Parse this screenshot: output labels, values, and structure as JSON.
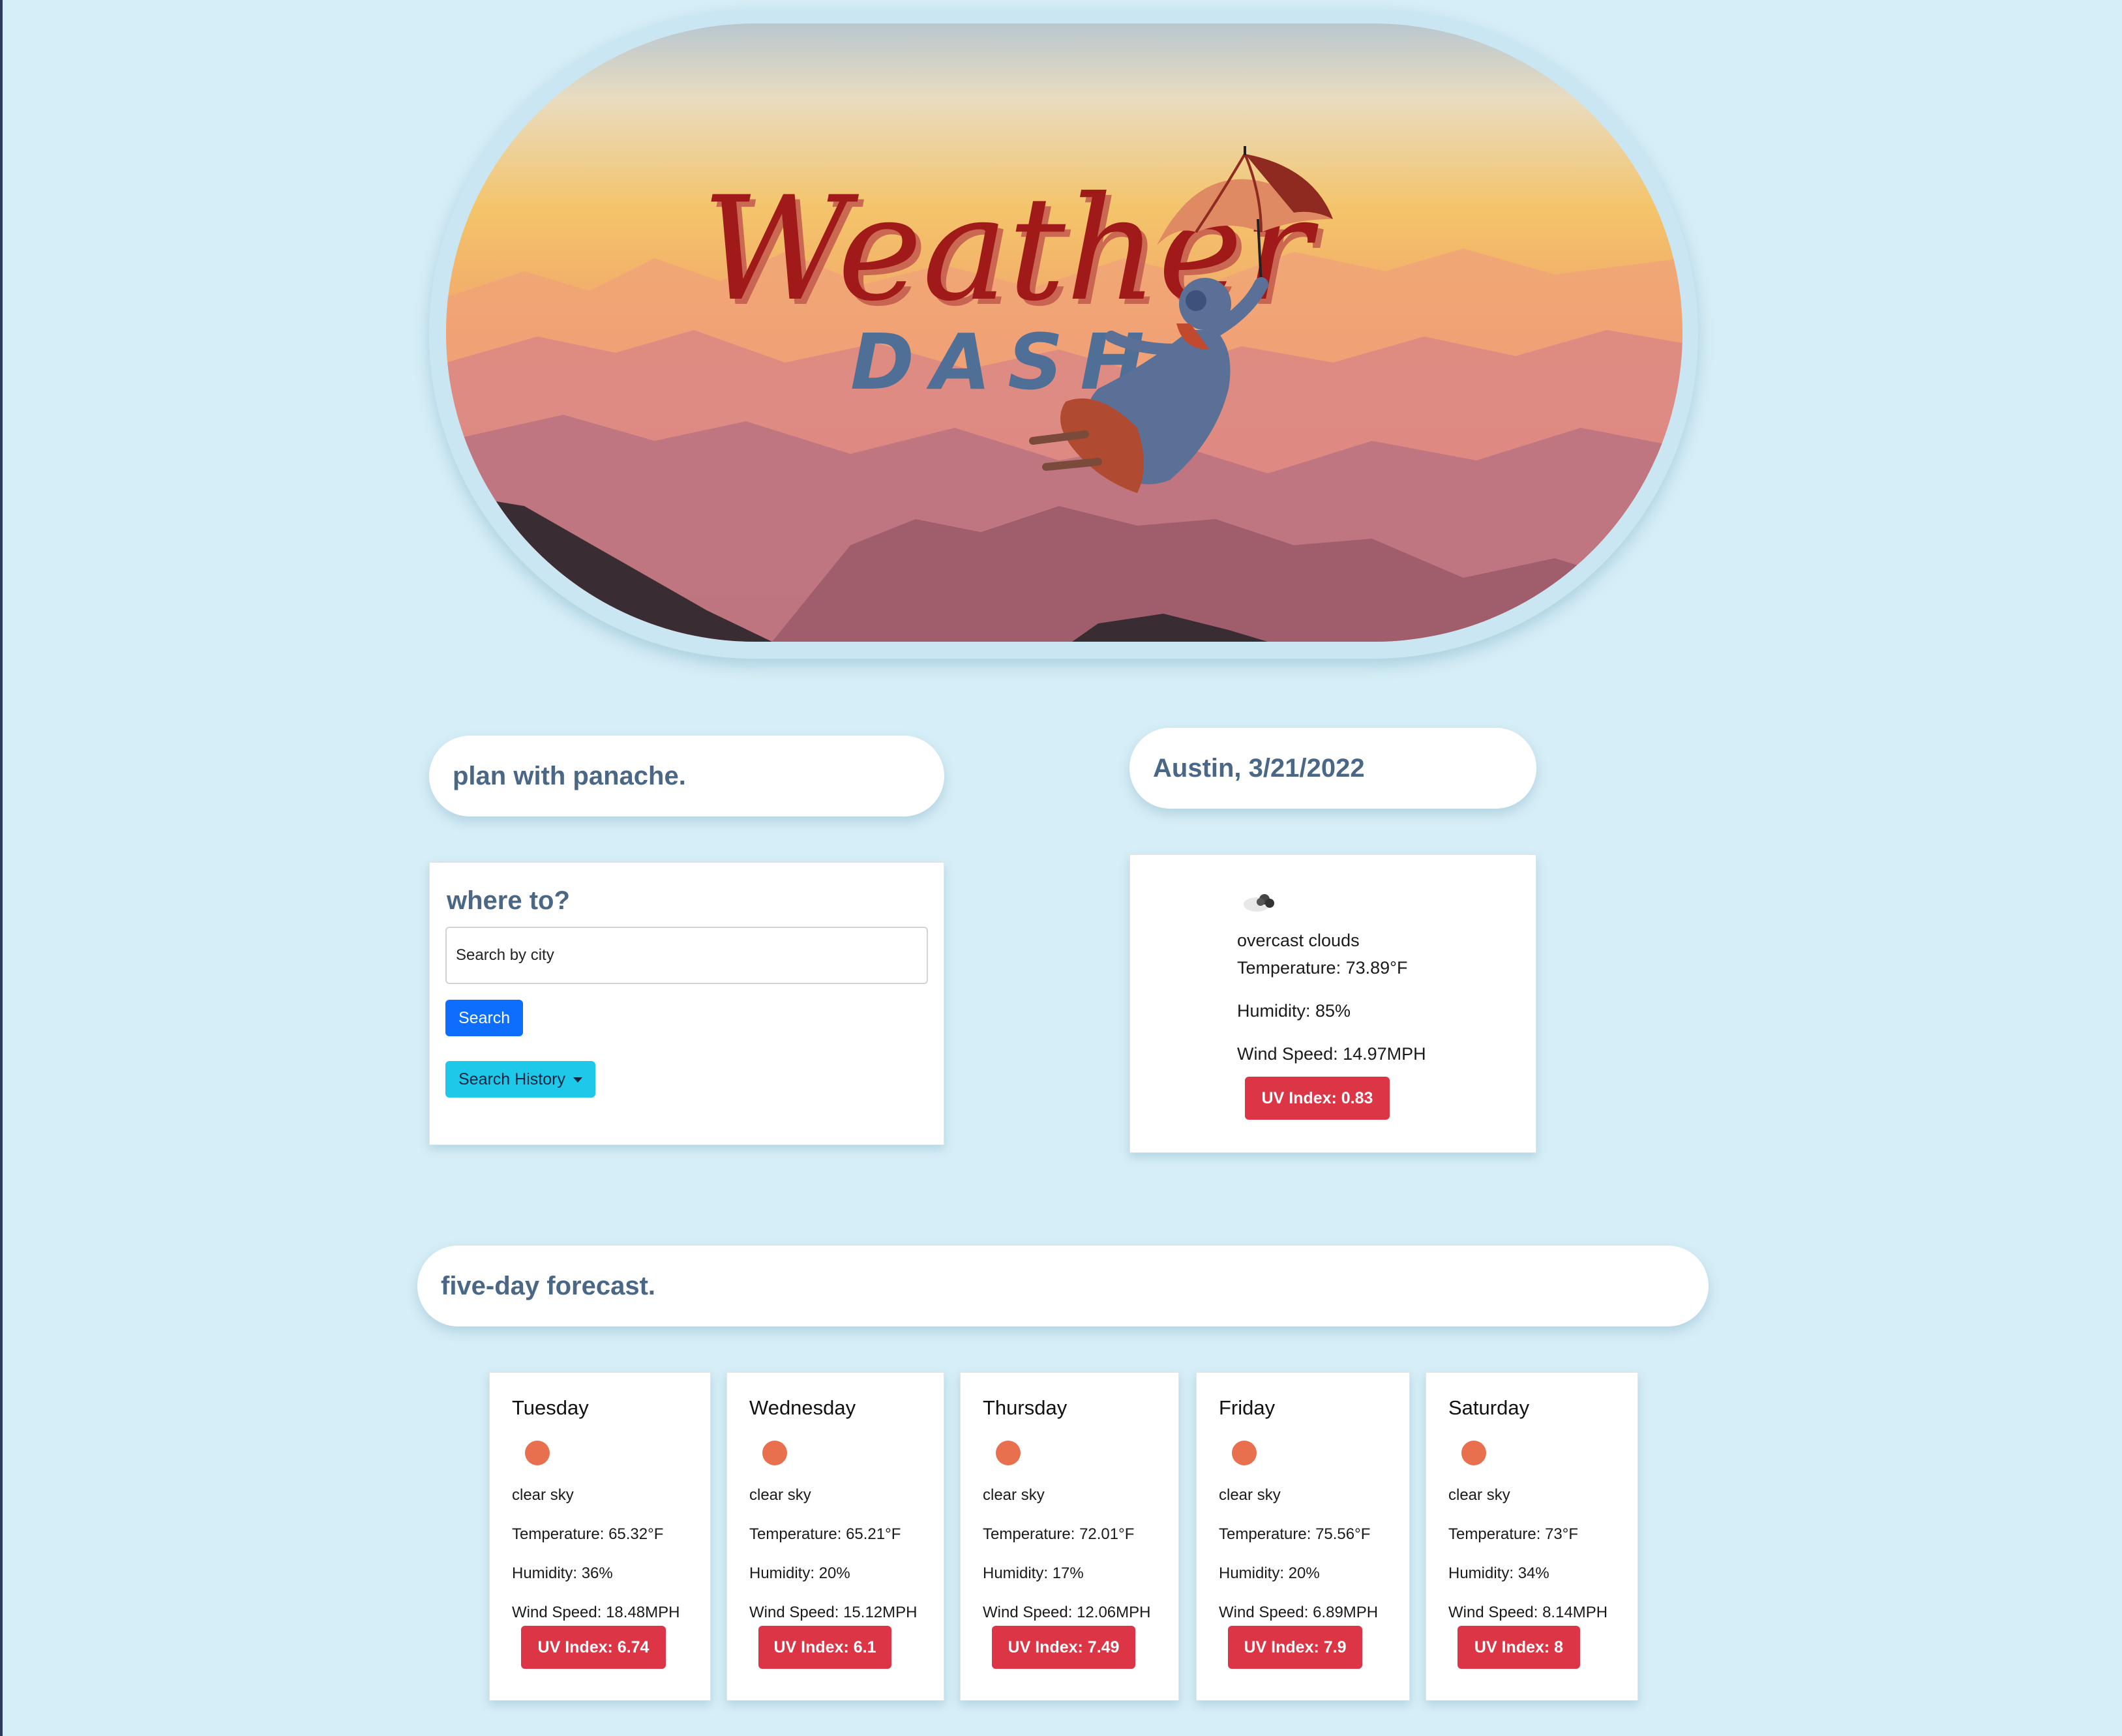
{
  "hero": {
    "logo_script": "Weather",
    "logo_sub": "DASH"
  },
  "tagline": "plan with panache.",
  "search": {
    "heading": "where to?",
    "placeholder": "Search by city",
    "search_label": "Search",
    "history_label": "Search History"
  },
  "current": {
    "city_date": "Austin, 3/21/2022",
    "icon": "cloud-icon",
    "description": "overcast clouds",
    "temperature": "Temperature: 73.89°F",
    "humidity": "Humidity: 85%",
    "wind": "Wind Speed: 14.97MPH",
    "uv": "UV Index: 0.83"
  },
  "forecast": {
    "heading": "five-day forecast.",
    "days": [
      {
        "day": "Tuesday",
        "icon": "sun-icon",
        "description": "clear sky",
        "temperature": "Temperature: 65.32°F",
        "humidity": "Humidity: 36%",
        "wind": "Wind Speed: 18.48MPH",
        "uv": "UV Index: 6.74"
      },
      {
        "day": "Wednesday",
        "icon": "sun-icon",
        "description": "clear sky",
        "temperature": "Temperature: 65.21°F",
        "humidity": "Humidity: 20%",
        "wind": "Wind Speed: 15.12MPH",
        "uv": "UV Index: 6.1"
      },
      {
        "day": "Thursday",
        "icon": "sun-icon",
        "description": "clear sky",
        "temperature": "Temperature: 72.01°F",
        "humidity": "Humidity: 17%",
        "wind": "Wind Speed: 12.06MPH",
        "uv": "UV Index: 7.49"
      },
      {
        "day": "Friday",
        "icon": "sun-icon",
        "description": "clear sky",
        "temperature": "Temperature: 75.56°F",
        "humidity": "Humidity: 20%",
        "wind": "Wind Speed: 6.89MPH",
        "uv": "UV Index: 7.9"
      },
      {
        "day": "Saturday",
        "icon": "sun-icon",
        "description": "clear sky",
        "temperature": "Temperature: 73°F",
        "humidity": "Humidity: 34%",
        "wind": "Wind Speed: 8.14MPH",
        "uv": "UV Index: 8"
      }
    ]
  },
  "colors": {
    "page_bg": "#d6eef7",
    "heading_text": "#4a6785",
    "uv_badge": "#dc3545",
    "search_button": "#0d6efd",
    "history_button": "#1ec8e8",
    "sun": "#e8704e",
    "logo_red": "#a01a1a",
    "logo_blue": "#4f6f96"
  }
}
